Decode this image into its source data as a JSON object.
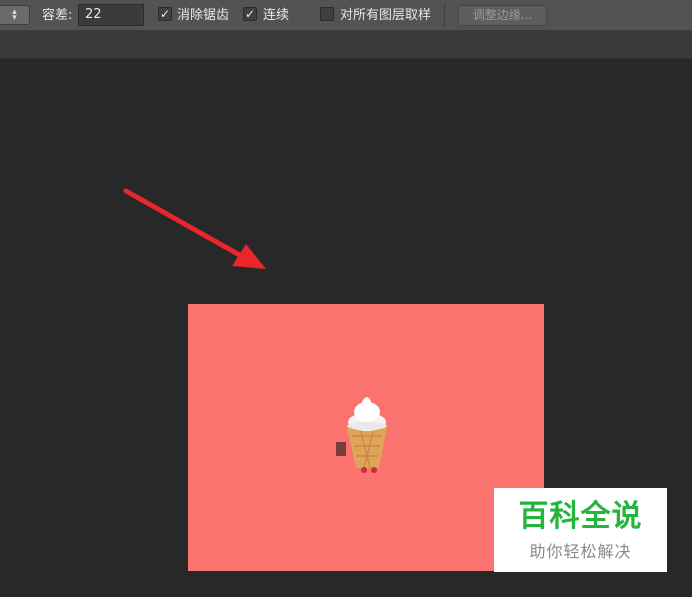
{
  "toolbar": {
    "tolerance_label": "容差:",
    "tolerance_value": "22",
    "antialias_label": "消除锯齿",
    "antialias_checked": true,
    "contiguous_label": "连续",
    "contiguous_checked": true,
    "sample_all_layers_label": "对所有图层取样",
    "sample_all_layers_checked": false,
    "refine_edge_label": "调整边缘..."
  },
  "canvas": {
    "document_color": "#fb736e",
    "annotation_arrow_color": "#e8262b"
  },
  "watermark": {
    "title": "百科全说",
    "subtitle": "助你轻松解决"
  }
}
